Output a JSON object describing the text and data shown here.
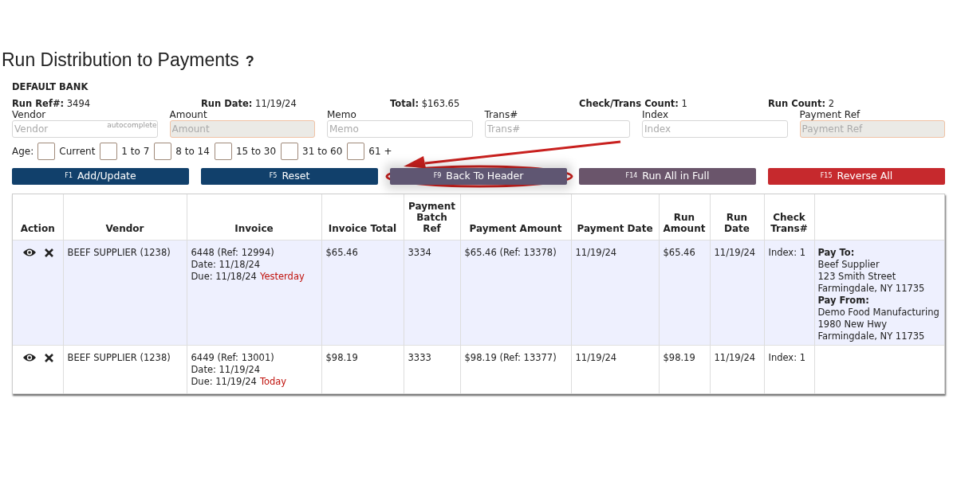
{
  "page_title": "Run Distribution to Payments",
  "help_icon": "?",
  "bank": "DEFAULT BANK",
  "summary": [
    {
      "label": "Run Ref#:",
      "value": "3494"
    },
    {
      "label": "Run Date:",
      "value": "11/19/24"
    },
    {
      "label": "Total:",
      "value": "$163.65"
    },
    {
      "label": "Check/Trans Count:",
      "value": "1"
    },
    {
      "label": "Run Count:",
      "value": "2"
    }
  ],
  "fields": [
    {
      "label": "Vendor",
      "placeholder": "Vendor",
      "hint": "autocomplete",
      "disabled": false
    },
    {
      "label": "Amount",
      "placeholder": "Amount",
      "disabled": true
    },
    {
      "label": "Memo",
      "placeholder": "Memo",
      "disabled": false
    },
    {
      "label": "Trans#",
      "placeholder": "Trans#",
      "disabled": false
    },
    {
      "label": "Index",
      "placeholder": "Index",
      "disabled": false
    },
    {
      "label": "Payment Ref",
      "placeholder": "Payment Ref",
      "disabled": true
    }
  ],
  "age": {
    "label": "Age:",
    "options": [
      {
        "label": "Current",
        "checked": false
      },
      {
        "label": "1 to 7",
        "checked": false
      },
      {
        "label": "8 to 14",
        "checked": false
      },
      {
        "label": "15 to 30",
        "checked": false
      },
      {
        "label": "31 to 60",
        "checked": false
      },
      {
        "label": "61 +",
        "checked": false
      }
    ]
  },
  "buttons": [
    {
      "key": "F1",
      "label": "Add/Update",
      "color": "#11406b",
      "annotated": false
    },
    {
      "key": "F5",
      "label": "Reset",
      "color": "#11406b",
      "annotated": false
    },
    {
      "key": "F9",
      "label": "Back To Header",
      "color": "#5f5672",
      "annotated": true
    },
    {
      "key": "F14",
      "label": "Run All in Full",
      "color": "#6a556b",
      "annotated": false
    },
    {
      "key": "F15",
      "label": "Reverse All",
      "color": "#c6292d",
      "annotated": false
    }
  ],
  "table": {
    "columns": [
      "Action",
      "Vendor",
      "Invoice",
      "Invoice Total",
      "Payment Batch Ref",
      "Payment Amount",
      "Payment Date",
      "Run Amount",
      "Run Date",
      "Check Trans#"
    ],
    "rows": [
      {
        "selected": true,
        "vendor": "BEEF SUPPLIER (1238)",
        "invoice": "6448 (Ref: 12994)",
        "invoice_date": "Date: 11/18/24",
        "due": "Due: 11/18/24",
        "due_note": "Yesterday",
        "invoice_total": "$65.46",
        "batch_ref": "3334",
        "payment_amount": "$65.46 (Ref: 13378)",
        "payment_date": "11/19/24",
        "run_amount": "$65.46",
        "run_date": "11/19/24",
        "check_trans": "Index: 1",
        "address": [
          {
            "kind": "heading",
            "text": "Pay To:"
          },
          {
            "kind": "line",
            "text": "Beef Supplier"
          },
          {
            "kind": "line",
            "text": "123 Smith Street"
          },
          {
            "kind": "line",
            "text": "Farmingdale, NY 11735"
          },
          {
            "kind": "heading",
            "text": "Pay From:"
          },
          {
            "kind": "line",
            "text": "Demo Food Manufacturing"
          },
          {
            "kind": "line",
            "text": "1980 New Hwy"
          },
          {
            "kind": "line",
            "text": "Farmingdale, NY 11735"
          }
        ]
      },
      {
        "selected": false,
        "vendor": "BEEF SUPPLIER (1238)",
        "invoice": "6449 (Ref: 13001)",
        "invoice_date": "Date: 11/19/24",
        "due": "Due: 11/19/24",
        "due_note": "Today",
        "invoice_total": "$98.19",
        "batch_ref": "3333",
        "payment_amount": "$98.19 (Ref: 13377)",
        "payment_date": "11/19/24",
        "run_amount": "$98.19",
        "run_date": "11/19/24",
        "check_trans": "Index: 1"
      }
    ]
  }
}
